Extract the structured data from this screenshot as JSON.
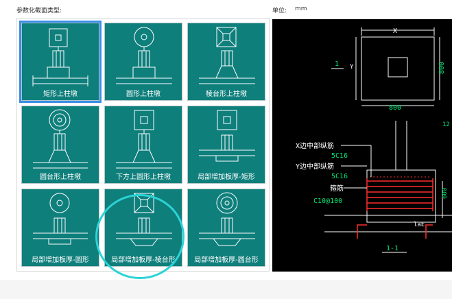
{
  "section_label": "参数化截面类型:",
  "unit": {
    "label": "单位:",
    "value": "mm"
  },
  "tiles": [
    {
      "label": "矩形上柱墩",
      "icon": "rect-column-pier-icon",
      "selected": true
    },
    {
      "label": "圆形上柱墩",
      "icon": "round-column-pier-icon",
      "selected": false
    },
    {
      "label": "棱台形上柱墩",
      "icon": "frustum-column-pier-icon",
      "selected": false
    },
    {
      "label": "圆台形上柱墩",
      "icon": "cone-frustum-column-pier-icon",
      "selected": false
    },
    {
      "label": "下方上圆形上柱墩",
      "icon": "square-round-column-pier-icon",
      "selected": false
    },
    {
      "label": "局部增加板厚-矩形",
      "icon": "local-thickening-rect-icon",
      "selected": false
    },
    {
      "label": "局部增加板厚-圆形",
      "icon": "local-thickening-round-icon",
      "selected": false
    },
    {
      "label": "局部增加板厚-棱台形",
      "icon": "local-thickening-frustum-icon",
      "selected": false
    },
    {
      "label": "局部增加板厚-圆台形",
      "icon": "local-thickening-cone-icon",
      "selected": false
    }
  ],
  "cad": {
    "plan": {
      "x_label": "X",
      "y_label": "Y",
      "dim_x": "800",
      "dim_y": "800",
      "section_mark": "1"
    },
    "rebar": {
      "x_mid_label": "X边中部纵筋",
      "x_mid_spec": "5C16",
      "y_mid_label": "Y边中部纵筋",
      "y_mid_spec": "5C16",
      "stirrup_label": "箍筋",
      "stirrup_spec": "C10@100",
      "height_dim": "600",
      "anchor": "laE",
      "partial": "12"
    },
    "section_title": "1-1"
  },
  "colors": {
    "tile_bg": "#0f7f7c",
    "selected_border": "#3a8ee6",
    "highlight": "#2cd3d6",
    "cad_bg": "#000000"
  }
}
